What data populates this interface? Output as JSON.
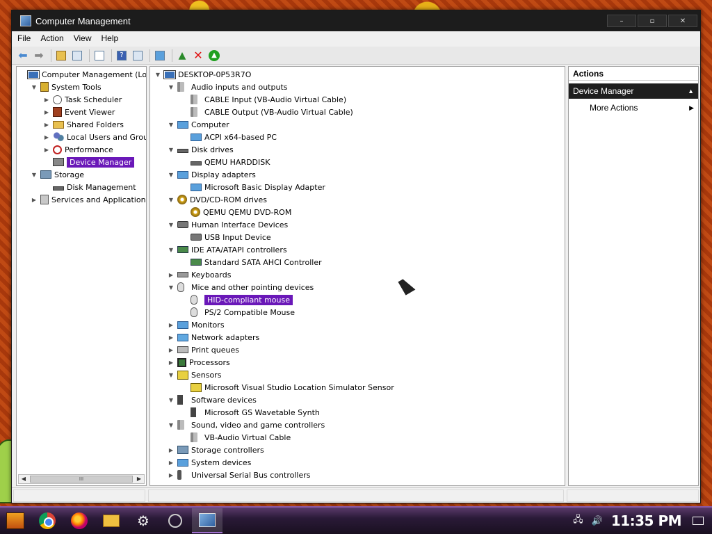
{
  "window": {
    "title": "Computer Management",
    "controls": {
      "minimize": "–",
      "maximize": "▫",
      "close": "✕"
    }
  },
  "menu": [
    "File",
    "Action",
    "View",
    "Help"
  ],
  "toolbar": {
    "icons": [
      "back-arrow-icon",
      "forward-arrow-icon",
      "up-folder-icon",
      "show-hide-tree-icon",
      "properties-icon",
      "help-icon",
      "action-pane-icon",
      "computer-icon",
      "update-driver-icon",
      "uninstall-icon",
      "enable-device-icon"
    ]
  },
  "left_tree": [
    {
      "label": "Computer Management (Local)",
      "level": 0,
      "toggle": "",
      "icon": "computer",
      "selected": false
    },
    {
      "label": "System Tools",
      "level": 1,
      "toggle": "▼",
      "icon": "tools",
      "selected": false
    },
    {
      "label": "Task Scheduler",
      "level": 2,
      "toggle": "▶",
      "icon": "clock",
      "selected": false
    },
    {
      "label": "Event Viewer",
      "level": 2,
      "toggle": "▶",
      "icon": "event",
      "selected": false
    },
    {
      "label": "Shared Folders",
      "level": 2,
      "toggle": "▶",
      "icon": "folder",
      "selected": false
    },
    {
      "label": "Local Users and Groups",
      "level": 2,
      "toggle": "▶",
      "icon": "users",
      "selected": false
    },
    {
      "label": "Performance",
      "level": 2,
      "toggle": "▶",
      "icon": "perf",
      "selected": false
    },
    {
      "label": "Device Manager",
      "level": 2,
      "toggle": "",
      "icon": "devmgr",
      "selected": true
    },
    {
      "label": "Storage",
      "level": 1,
      "toggle": "▼",
      "icon": "storage",
      "selected": false
    },
    {
      "label": "Disk Management",
      "level": 2,
      "toggle": "",
      "icon": "drive",
      "selected": false
    },
    {
      "label": "Services and Applications",
      "level": 1,
      "toggle": "▶",
      "icon": "services",
      "selected": false
    }
  ],
  "left_scrollbar": {
    "left": "◀",
    "thumb": "III",
    "right": "▶"
  },
  "device_tree": [
    {
      "label": "DESKTOP-0P53R7O",
      "level": 0,
      "toggle": "▼",
      "icon": "computer",
      "selected": false
    },
    {
      "label": "Audio inputs and outputs",
      "level": 1,
      "toggle": "▼",
      "icon": "speaker",
      "selected": false
    },
    {
      "label": "CABLE Input (VB-Audio Virtual Cable)",
      "level": 2,
      "toggle": "",
      "icon": "speaker",
      "selected": false
    },
    {
      "label": "CABLE Output (VB-Audio Virtual Cable)",
      "level": 2,
      "toggle": "",
      "icon": "speaker",
      "selected": false
    },
    {
      "label": "Computer",
      "level": 1,
      "toggle": "▼",
      "icon": "monitor",
      "selected": false
    },
    {
      "label": "ACPI x64-based PC",
      "level": 2,
      "toggle": "",
      "icon": "monitor",
      "selected": false
    },
    {
      "label": "Disk drives",
      "level": 1,
      "toggle": "▼",
      "icon": "drive",
      "selected": false
    },
    {
      "label": "QEMU HARDDISK",
      "level": 2,
      "toggle": "",
      "icon": "drive",
      "selected": false
    },
    {
      "label": "Display adapters",
      "level": 1,
      "toggle": "▼",
      "icon": "monitor",
      "selected": false
    },
    {
      "label": "Microsoft Basic Display Adapter",
      "level": 2,
      "toggle": "",
      "icon": "monitor",
      "selected": false
    },
    {
      "label": "DVD/CD-ROM drives",
      "level": 1,
      "toggle": "▼",
      "icon": "disc",
      "selected": false
    },
    {
      "label": "QEMU QEMU DVD-ROM",
      "level": 2,
      "toggle": "",
      "icon": "disc",
      "selected": false
    },
    {
      "label": "Human Interface Devices",
      "level": 1,
      "toggle": "▼",
      "icon": "hid",
      "selected": false
    },
    {
      "label": "USB Input Device",
      "level": 2,
      "toggle": "",
      "icon": "hid",
      "selected": false
    },
    {
      "label": "IDE ATA/ATAPI controllers",
      "level": 1,
      "toggle": "▼",
      "icon": "ide",
      "selected": false
    },
    {
      "label": "Standard SATA AHCI Controller",
      "level": 2,
      "toggle": "",
      "icon": "ide",
      "selected": false
    },
    {
      "label": "Keyboards",
      "level": 1,
      "toggle": "▶",
      "icon": "keyboard",
      "selected": false
    },
    {
      "label": "Mice and other pointing devices",
      "level": 1,
      "toggle": "▼",
      "icon": "mouse",
      "selected": false
    },
    {
      "label": "HID-compliant mouse",
      "level": 2,
      "toggle": "",
      "icon": "mouse",
      "selected": true
    },
    {
      "label": "PS/2 Compatible Mouse",
      "level": 2,
      "toggle": "",
      "icon": "mouse",
      "selected": false
    },
    {
      "label": "Monitors",
      "level": 1,
      "toggle": "▶",
      "icon": "monitor",
      "selected": false
    },
    {
      "label": "Network adapters",
      "level": 1,
      "toggle": "▶",
      "icon": "network",
      "selected": false
    },
    {
      "label": "Print queues",
      "level": 1,
      "toggle": "▶",
      "icon": "printer",
      "selected": false
    },
    {
      "label": "Processors",
      "level": 1,
      "toggle": "▶",
      "icon": "cpu",
      "selected": false
    },
    {
      "label": "Sensors",
      "level": 1,
      "toggle": "▼",
      "icon": "sensor",
      "selected": false
    },
    {
      "label": "Microsoft Visual Studio Location Simulator Sensor",
      "level": 2,
      "toggle": "",
      "icon": "sensor",
      "selected": false
    },
    {
      "label": "Software devices",
      "level": 1,
      "toggle": "▼",
      "icon": "software",
      "selected": false
    },
    {
      "label": "Microsoft GS Wavetable Synth",
      "level": 2,
      "toggle": "",
      "icon": "software",
      "selected": false
    },
    {
      "label": "Sound, video and game controllers",
      "level": 1,
      "toggle": "▼",
      "icon": "speaker",
      "selected": false
    },
    {
      "label": "VB-Audio Virtual Cable",
      "level": 2,
      "toggle": "",
      "icon": "speaker",
      "selected": false
    },
    {
      "label": "Storage controllers",
      "level": 1,
      "toggle": "▶",
      "icon": "storage",
      "selected": false
    },
    {
      "label": "System devices",
      "level": 1,
      "toggle": "▶",
      "icon": "monitor",
      "selected": false
    },
    {
      "label": "Universal Serial Bus controllers",
      "level": 1,
      "toggle": "▶",
      "icon": "usb",
      "selected": false
    }
  ],
  "actions": {
    "header": "Actions",
    "section": "Device Manager",
    "section_caret": "▲",
    "more": "More Actions",
    "more_arrow": "▶"
  },
  "taskbar": {
    "items": [
      "start-icon",
      "chrome-icon",
      "firefox-icon",
      "file-explorer-icon",
      "settings-gear-icon",
      "audio-app-icon",
      "computer-management-icon"
    ],
    "gear_glyph": "⚙",
    "tray": {
      "network": "🖧",
      "volume": "🔊",
      "clock": "11:35 PM",
      "notification": ""
    }
  },
  "colors": {
    "selection": "#6a18b8",
    "titlebar": "#1c1c1c",
    "taskbar_accent": "#8a5aa8"
  }
}
